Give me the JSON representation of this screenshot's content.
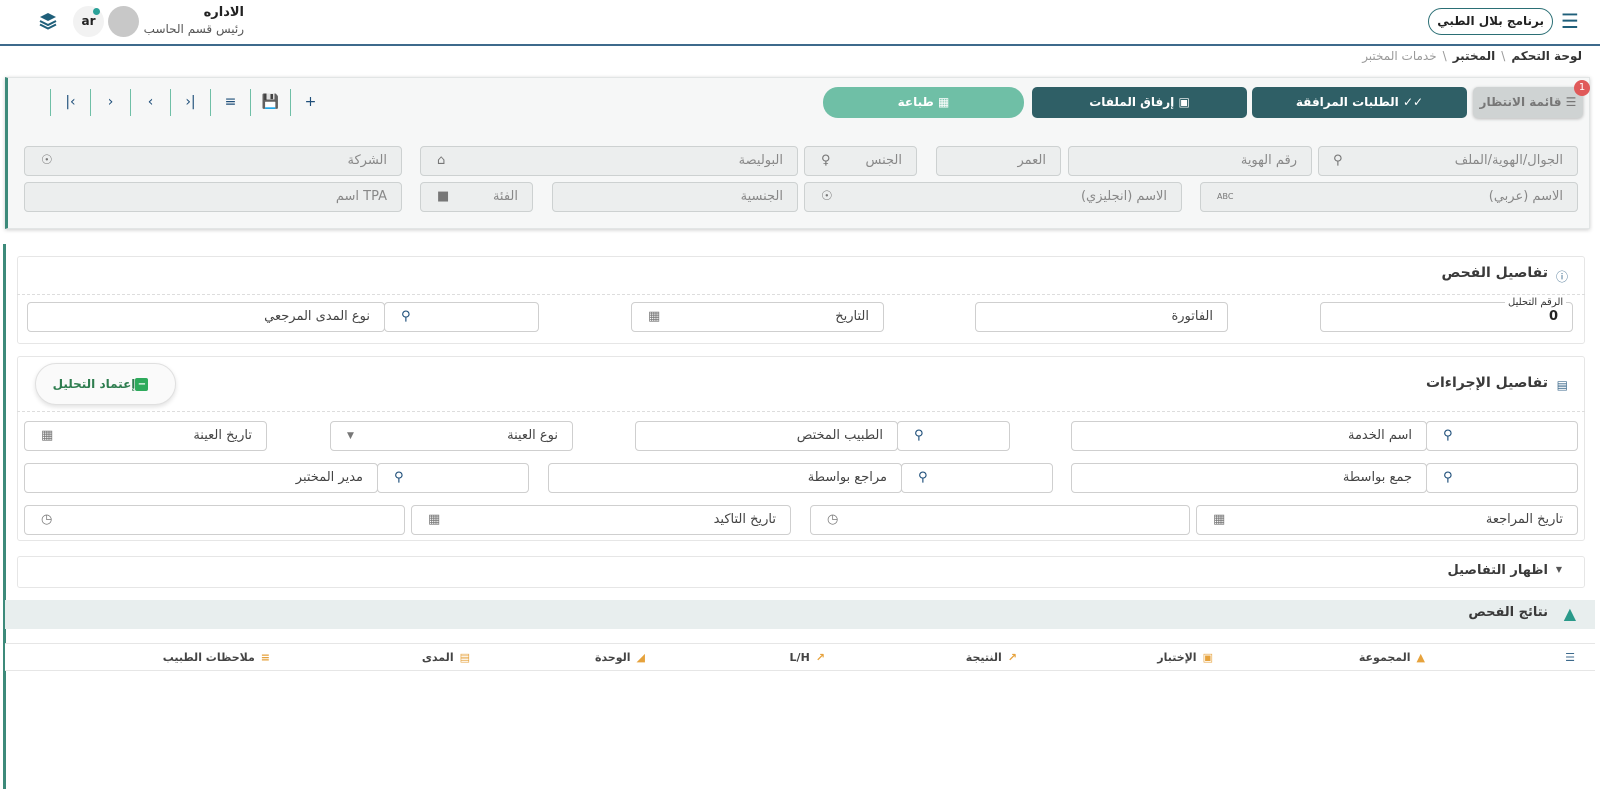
{
  "topbar": {
    "brand": "برنامج بلال الطبي",
    "user_name": "الاداره",
    "user_role": "رئيس قسم الحاسب",
    "lang": "ar"
  },
  "breadcrumb": {
    "items": [
      "لوحة التحكم",
      "المختبر",
      "خدمات المختبر"
    ],
    "sep": "\\"
  },
  "toolbar": {
    "waiting_list": "قائمة الانتظار",
    "waiting_badge": "1",
    "attached_requests": "الطلبات المرافقة",
    "attach_files": "إرفاق الملفات",
    "print": "طباعة"
  },
  "patient_fields": {
    "search_placeholder": "الجوال/الهوية/الملف",
    "id_number": "رقم الهوية",
    "age": "العمر",
    "gender": "الجنس",
    "policy": "البوليصة",
    "company": "الشركة",
    "name_ar": "الاسم (عربي)",
    "name_en": "الاسم (انجليزي)",
    "nationality": "الجنسية",
    "category": "الفئة",
    "tpa_name": "اسم TPA"
  },
  "exam_details": {
    "title": "تفاصيل الفحص",
    "analysis_no_label": "الرقم التحليل",
    "analysis_no_value": "0",
    "invoice": "الفاتورة",
    "date": "التاريخ",
    "reference_range_type": "نوع المدى المرجعي"
  },
  "procedure_details": {
    "title": "تفاصيل الإجراءات",
    "approve_button": "إعتماد التحليل",
    "service_name": "اسم الخدمة",
    "specialist": "الطبيب المختص",
    "sample_type": "نوع العينة",
    "sample_date": "تاريخ العينة",
    "collected_by": "جمع بواسطة",
    "reviewed_by": "مراجع بواسطة",
    "lab_manager": "مدير المختبر",
    "review_date": "تاريخ المراجعة",
    "confirm_date": "تاريخ التاكيد"
  },
  "show_details": "اظهار التفاصيل",
  "results": {
    "title": "نتائج الفحص",
    "columns": [
      "المجموعة",
      "الإختبار",
      "النتيجة",
      "L/H",
      "الوحدة",
      "المدى",
      "ملاحظات الطبيب"
    ]
  },
  "colors": {
    "primary_dark": "#2f5f66",
    "accent_green": "#6fbfa6",
    "nav_blue": "#1f4f7a"
  }
}
